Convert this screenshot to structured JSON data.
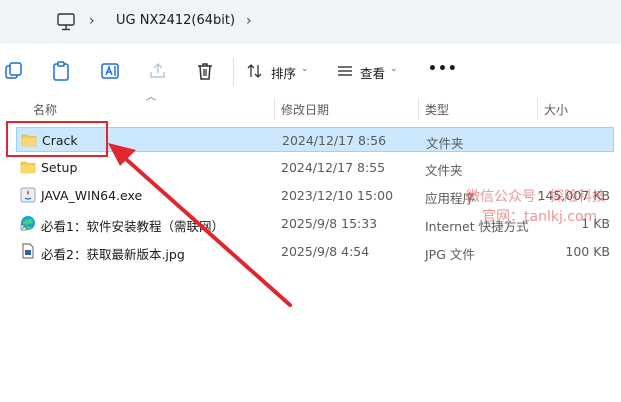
{
  "address_bar": {
    "icon": "computer-icon",
    "crumb": "UG NX2412(64bit)"
  },
  "toolbar": {
    "sort_label": "排序",
    "view_label": "查看",
    "more_label": "•••"
  },
  "columns": {
    "name": "名称",
    "date": "修改日期",
    "type": "类型",
    "size": "大小"
  },
  "files": [
    {
      "name": "Crack",
      "date": "2024/12/17 8:56",
      "type": "文件夹",
      "size": "",
      "icon": "folder-icon",
      "selected": true
    },
    {
      "name": "Setup",
      "date": "2024/12/17 8:55",
      "type": "文件夹",
      "size": "",
      "icon": "folder-icon",
      "selected": false
    },
    {
      "name": "JAVA_WIN64.exe",
      "date": "2023/12/10 15:00",
      "type": "应用程序",
      "size": "145,007 KB",
      "icon": "java-exe-icon",
      "selected": false
    },
    {
      "name": "必看1：软件安装教程（需联网）",
      "date": "2025/9/8 15:33",
      "type": "Internet 快捷方式",
      "size": "1 KB",
      "icon": "edge-shortcut-icon",
      "selected": false
    },
    {
      "name": "必看2：获取最新版本.jpg",
      "date": "2025/9/8 4:54",
      "type": "JPG 文件",
      "size": "100 KB",
      "icon": "image-file-icon",
      "selected": false
    }
  ],
  "watermark": {
    "line1": "微信公众号：探险科技",
    "line2": "官网：tanlkj.com"
  },
  "colors": {
    "selection": "#cce8ff",
    "annotation_red": "#e0262f",
    "folder_yellow": "#f8c94e"
  }
}
